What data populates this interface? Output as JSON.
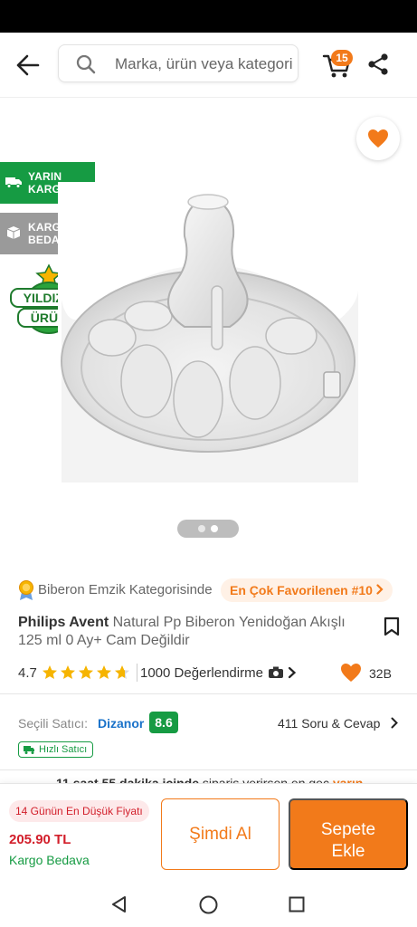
{
  "header": {
    "search_placeholder": "Marka, ürün veya kategori ara",
    "cart_count": "15"
  },
  "gallery": {
    "tag_cargo": [
      "YARIN",
      "KARGODA"
    ],
    "tag_free": [
      "KARGO",
      "BEDAVA"
    ],
    "star_badge": [
      "YILDIZLI",
      "ÜRÜN"
    ],
    "slide_count": 2,
    "active_slide": 2
  },
  "product": {
    "category_text": "Biberon Emzik Kategorisinde",
    "category_pill": "En Çok Favorilenen #10",
    "brand": "Philips Avent",
    "title": " Natural Pp Biberon Yenidoğan Akışlı 125 ml 0 Ay+ Cam Değildir",
    "rating": "4.7",
    "rating_value": 4.7,
    "review_count": "1000 Değerlendirme",
    "likes": "32B"
  },
  "seller": {
    "label": "Seçili Satıcı:",
    "name": "Dizanor",
    "score": "8.6",
    "qa": "411 Soru & Cevap",
    "fast_seller": "Hızlı Satıcı"
  },
  "delivery": {
    "prefix": "11 saat 55 dakika içinde",
    "middle": " sipariş verirsen en geç ",
    "highlight": "yarın"
  },
  "bottom": {
    "low_price_badge": "14 Günün En Düşük Fiyatı",
    "price": "205.90 TL",
    "free_shipping": "Kargo Bedava",
    "buy_now": "Şimdi Al",
    "add_to_cart_1": "Sepete",
    "add_to_cart_2": "Ekle"
  },
  "colors": {
    "brand_orange": "#f27a1a",
    "green": "#169b43",
    "price_red": "#d21e2a",
    "seller_blue": "#1a72c9"
  },
  "icons": [
    "back-arrow-icon",
    "search-icon",
    "cart-icon",
    "share-icon",
    "heart-icon",
    "truck-icon",
    "box-icon",
    "medal-icon",
    "bookmark-icon",
    "star-icon",
    "camera-icon",
    "chevron-right-icon",
    "triangle-back-icon",
    "circle-home-icon",
    "square-recent-icon"
  ]
}
